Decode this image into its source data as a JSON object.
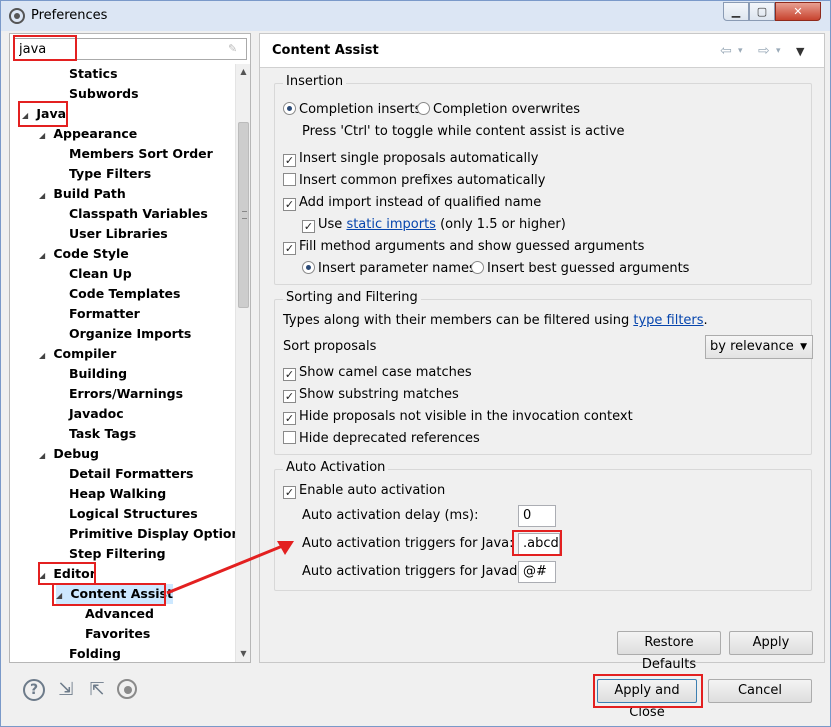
{
  "window": {
    "title": "Preferences",
    "min": "0",
    "max": "1",
    "close": "r"
  },
  "filter": {
    "value": "java"
  },
  "tree": {
    "items": [
      {
        "label": "Statics"
      },
      {
        "label": "Subwords"
      },
      {
        "label": "Java"
      },
      {
        "label": "Appearance"
      },
      {
        "label": "Members Sort Order"
      },
      {
        "label": "Type Filters"
      },
      {
        "label": "Build Path"
      },
      {
        "label": "Classpath Variables"
      },
      {
        "label": "User Libraries"
      },
      {
        "label": "Code Style"
      },
      {
        "label": "Clean Up"
      },
      {
        "label": "Code Templates"
      },
      {
        "label": "Formatter"
      },
      {
        "label": "Organize Imports"
      },
      {
        "label": "Compiler"
      },
      {
        "label": "Building"
      },
      {
        "label": "Errors/Warnings"
      },
      {
        "label": "Javadoc"
      },
      {
        "label": "Task Tags"
      },
      {
        "label": "Debug"
      },
      {
        "label": "Detail Formatters"
      },
      {
        "label": "Heap Walking"
      },
      {
        "label": "Logical Structures"
      },
      {
        "label": "Primitive Display Options"
      },
      {
        "label": "Step Filtering"
      },
      {
        "label": "Editor"
      },
      {
        "label": "Content Assist"
      },
      {
        "label": "Advanced"
      },
      {
        "label": "Favorites"
      },
      {
        "label": "Folding"
      }
    ]
  },
  "page": {
    "title": "Content Assist",
    "insertion": {
      "label": "Insertion",
      "completion_inserts": "Completion inserts",
      "completion_overwrites": "Completion overwrites",
      "toggle_hint": "Press 'Ctrl' to toggle while content assist is active",
      "insert_single": "Insert single proposals automatically",
      "insert_common": "Insert common prefixes automatically",
      "add_import": "Add import instead of qualified name",
      "use_prefix": "Use",
      "static_imports": "static imports",
      "use_suffix": "(only 1.5 or higher)",
      "fill_args": "Fill method arguments and show guessed arguments",
      "insert_param_names": "Insert parameter names",
      "insert_best_guessed": "Insert best guessed arguments"
    },
    "sorting": {
      "label": "Sorting and Filtering",
      "desc_prefix": "Types along with their members can be filtered using",
      "type_filters": "type filters",
      "desc_suffix": ".",
      "sort_label": "Sort proposals",
      "sort_value": "by relevance",
      "camel": "Show camel case matches",
      "substring": "Show substring matches",
      "hide_not_visible": "Hide proposals not visible in the invocation context",
      "hide_deprecated": "Hide deprecated references"
    },
    "auto": {
      "label": "Auto Activation",
      "enable": "Enable auto activation",
      "delay_label": "Auto activation delay (ms):",
      "delay_value": "0",
      "java_label": "Auto activation triggers for Java:",
      "java_value": ".abcd",
      "javadoc_label": "Auto activation triggers for Javadoc:",
      "javadoc_value": "@#"
    },
    "restore_defaults": "Restore Defaults",
    "apply": "Apply"
  },
  "footer": {
    "apply_close": "Apply and Close",
    "cancel": "Cancel"
  },
  "checks": {
    "mark": "✓"
  }
}
